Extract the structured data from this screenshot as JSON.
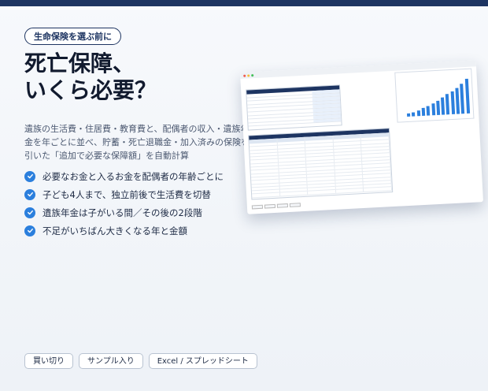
{
  "badge": "生命保険を選ぶ前に",
  "headline": {
    "line1": "死亡保障、",
    "line2": "いくら必要？"
  },
  "description": {
    "line1": "遺族の生活費・住居費・教育費と、配偶者の収入・遺族年",
    "line2": "金を年ごとに並べ、貯蓄・死亡退職金・加入済みの保険を",
    "line3": "引いた「追加で必要な保障額」を自動計算"
  },
  "features": [
    "必要なお金と入るお金を配偶者の年齢ごとに",
    "子ども4人まで、独立前後で生活費を切替",
    "遺族年金は子がいる間／その後の2段階",
    "不足がいちばん大きくなる年と金額"
  ],
  "tags": [
    "買い切り",
    "サンプル入り",
    "Excel / スプレッドシート"
  ],
  "mockup": {
    "chart_heights": [
      0.08,
      0.12,
      0.16,
      0.22,
      0.28,
      0.35,
      0.42,
      0.5,
      0.58,
      0.67,
      0.76,
      0.86,
      1.0
    ]
  },
  "colors": {
    "navy": "#1d3461",
    "accent": "#2b7fdd"
  }
}
